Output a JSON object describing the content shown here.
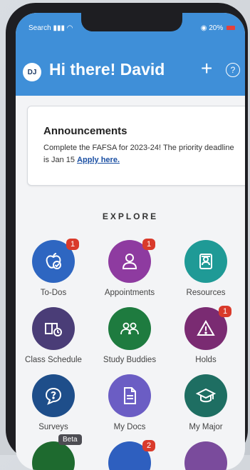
{
  "status_bar": {
    "left": "Search",
    "right": "20%"
  },
  "header": {
    "avatar_initials": "DJ",
    "greeting": "Hi there! David",
    "add_symbol": "+",
    "help_symbol": "?"
  },
  "announcement": {
    "title": "Announcements",
    "body": "Complete the FAFSA for 2023-24! The priority deadline is Jan 15",
    "link": "Apply here."
  },
  "explore": {
    "heading": "EXPLORE",
    "tiles": [
      {
        "label": "To-Dos",
        "badge": "1",
        "icon": "apple-check-icon",
        "color": "#2e66c1"
      },
      {
        "label": "Appointments",
        "badge": "1",
        "icon": "person-icon",
        "color": "#8e3ba0"
      },
      {
        "label": "Resources",
        "badge": "",
        "icon": "resources-icon",
        "color": "#1f9a96"
      },
      {
        "label": "Class Schedule",
        "badge": "",
        "icon": "book-clock-icon",
        "color": "#4a3d77"
      },
      {
        "label": "Study Buddies",
        "badge": "",
        "icon": "group-icon",
        "color": "#1e7b3f"
      },
      {
        "label": "Holds",
        "badge": "1",
        "icon": "warning-icon",
        "color": "#7a2b72"
      },
      {
        "label": "Surveys",
        "badge": "",
        "icon": "chat-question-icon",
        "color": "#1e4e8a"
      },
      {
        "label": "My Docs",
        "badge": "",
        "icon": "document-icon",
        "color": "#6b5dc4"
      },
      {
        "label": "My Major",
        "badge": "",
        "icon": "graduation-cap-icon",
        "color": "#1e6e62"
      }
    ],
    "partial_row": {
      "beta_label": "Beta",
      "badge": "2"
    }
  }
}
